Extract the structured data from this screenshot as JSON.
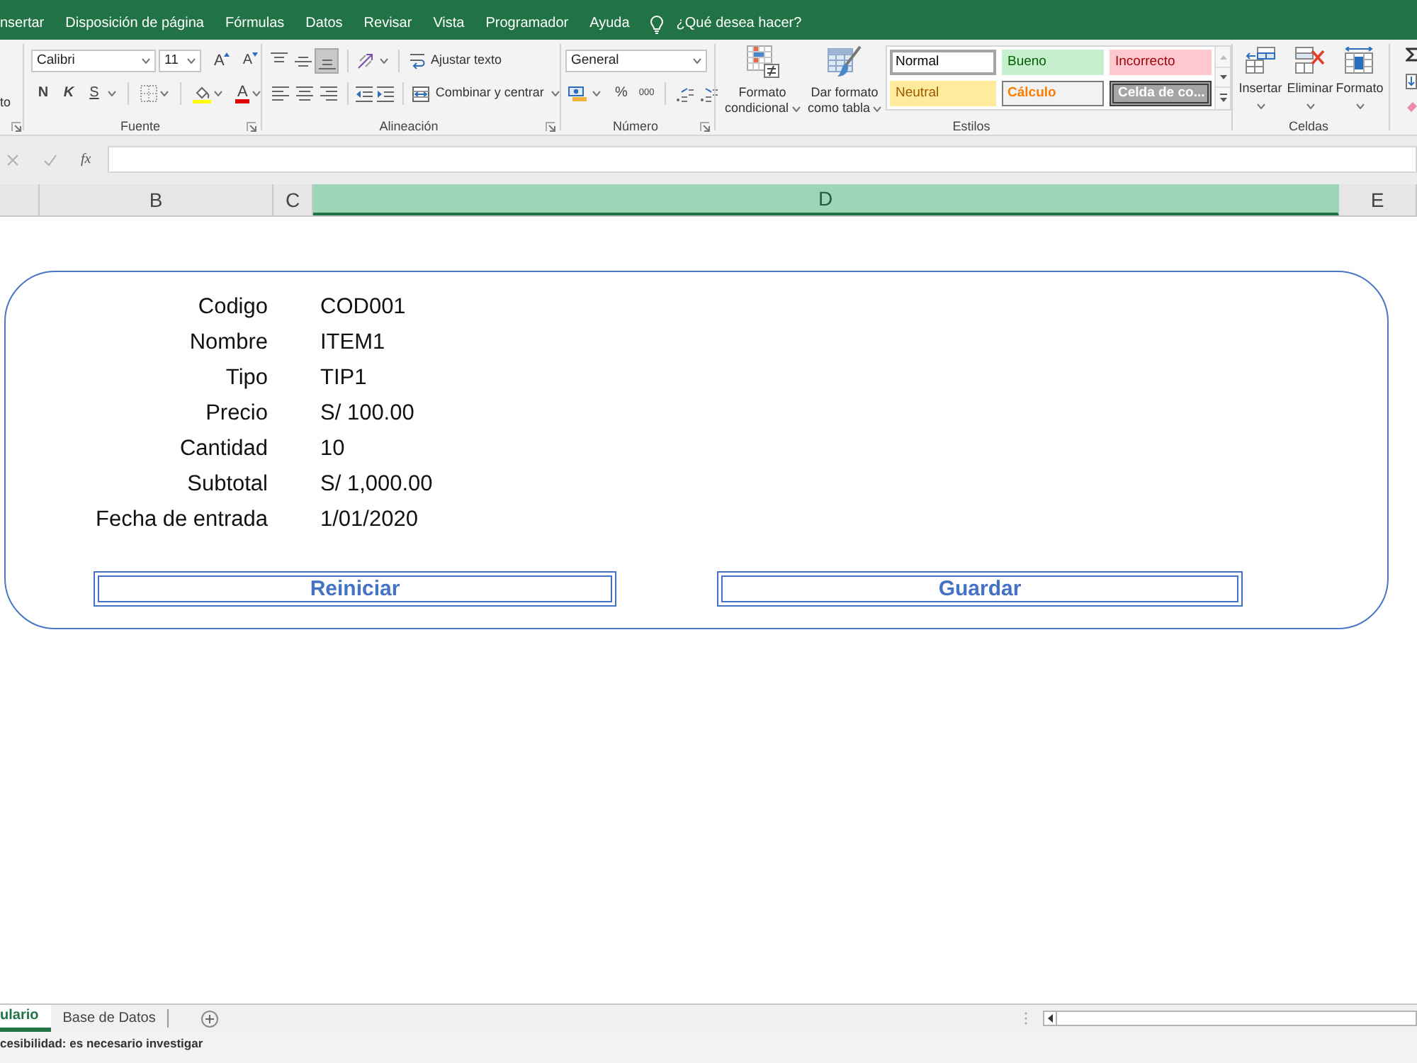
{
  "menu_tabs": [
    {
      "label": "nsertar"
    },
    {
      "label": "Disposición de página"
    },
    {
      "label": "Fórmulas"
    },
    {
      "label": "Datos"
    },
    {
      "label": "Revisar"
    },
    {
      "label": "Vista"
    },
    {
      "label": "Programador"
    },
    {
      "label": "Ayuda"
    }
  ],
  "tell_me": "¿Qué desea hacer?",
  "ribbon": {
    "clipboard": {
      "fragment": "to"
    },
    "font": {
      "label": "Fuente",
      "font_name": "Calibri",
      "font_size": "11",
      "grow": "A",
      "shrink": "A",
      "bold": "N",
      "italic": "K",
      "underline": "S",
      "font_color": "A"
    },
    "alignment": {
      "label": "Alineación",
      "vertical": [
        {
          "selected": false
        },
        {
          "selected": false
        },
        {
          "selected": true
        }
      ],
      "wrap_text": "Ajustar texto",
      "merge": "Combinar y centrar"
    },
    "number": {
      "label": "Número",
      "format": "General",
      "percent": "%",
      "thousands": "000"
    },
    "styles": {
      "label": "Estilos",
      "conditional_format": [
        "Formato",
        "condicional"
      ],
      "format_as_table": [
        "Dar formato",
        "como tabla"
      ],
      "gallery": [
        {
          "label": "Normal",
          "kind": "normal",
          "selected": true
        },
        {
          "label": "Bueno",
          "kind": "good",
          "selected": false
        },
        {
          "label": "Incorrecto",
          "kind": "bad",
          "selected": false
        },
        {
          "label": "Neutral",
          "kind": "neutral",
          "selected": false
        },
        {
          "label": "Cálculo",
          "kind": "calculation",
          "selected": false
        },
        {
          "label": "Celda de co...",
          "kind": "check",
          "selected": false
        }
      ]
    },
    "cells": {
      "label": "Celdas",
      "buttons": [
        "Insertar",
        "Eliminar",
        "Formato"
      ]
    }
  },
  "formula_bar": {
    "function_label": "fx"
  },
  "columns": [
    {
      "label": "B",
      "selected": false
    },
    {
      "label": "C",
      "selected": false
    },
    {
      "label": "D",
      "selected": true
    },
    {
      "label": "E",
      "selected": false
    }
  ],
  "form": {
    "fields": [
      {
        "label": "Codigo",
        "value": "COD001"
      },
      {
        "label": "Nombre",
        "value": "ITEM1"
      },
      {
        "label": "Tipo",
        "value": "TIP1"
      },
      {
        "label": "Precio",
        "value": "S/ 100.00"
      },
      {
        "label": "Cantidad",
        "value": "10"
      },
      {
        "label": "Subtotal",
        "value": "S/ 1,000.00"
      },
      {
        "label": "Fecha de entrada",
        "value": "1/01/2020"
      }
    ],
    "buttons": [
      "Reiniciar",
      "Guardar"
    ]
  },
  "sheet_tabs": [
    {
      "label": "ulario",
      "selected": true
    },
    {
      "label": "Base de Datos",
      "selected": false
    }
  ],
  "status_bar": {
    "text": "cesibilidad: es necesario investigar"
  }
}
